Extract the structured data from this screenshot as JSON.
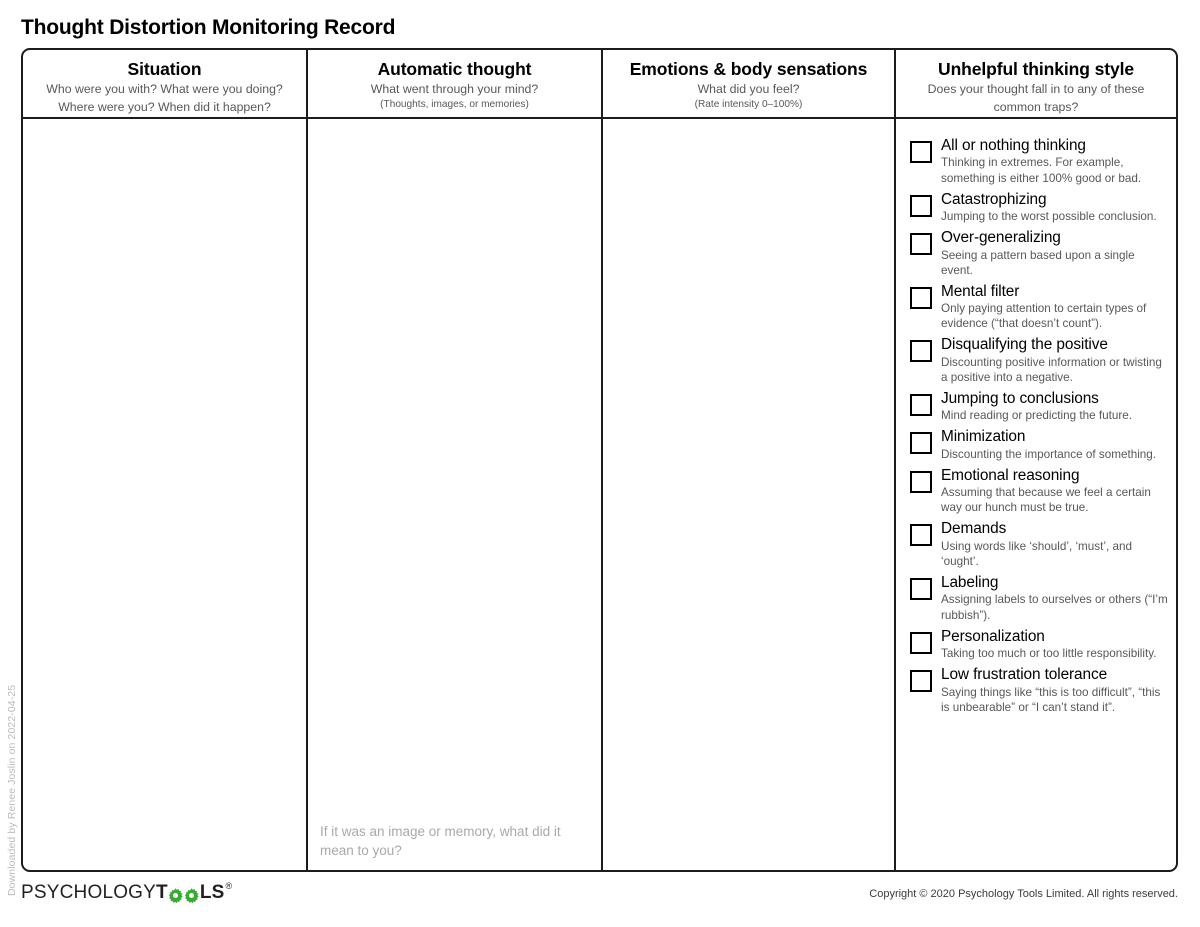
{
  "document": {
    "title": "Thought Distortion Monitoring Record",
    "download_stamp": "Downloaded by Renee Joslin on 2022-04-25"
  },
  "table": {
    "columns": [
      {
        "id": "situation",
        "title": "Situation",
        "subtitle_line1": "Who were you with? What were you doing?",
        "subtitle_line2": "Where were you?  When did it happen?"
      },
      {
        "id": "automatic-thought",
        "title": "Automatic thought",
        "subtitle_line1": "What went through your mind?",
        "subtitle_small": "(Thoughts, images, or memories)",
        "body_hint": "If it was an image or memory, what did it mean to you?"
      },
      {
        "id": "emotions",
        "title": "Emotions & body sensations",
        "subtitle_line1": "What did you feel?",
        "subtitle_small": "(Rate intensity 0–100%)"
      },
      {
        "id": "unhelpful-thinking-style",
        "title": "Unhelpful thinking style",
        "subtitle_line1": "Does your thought fall in to any of these",
        "subtitle_line2": "common traps?"
      }
    ]
  },
  "distortions": [
    {
      "label": "All or nothing thinking",
      "description": "Thinking in extremes. For example, something is either 100% good or bad.",
      "checked": false
    },
    {
      "label": "Catastrophizing",
      "description": "Jumping to the worst possible conclusion.",
      "checked": false
    },
    {
      "label": "Over-generalizing",
      "description": "Seeing a pattern based upon a single event.",
      "checked": false
    },
    {
      "label": "Mental filter",
      "description": "Only paying attention to certain types of evidence (“that doesn’t count”).",
      "checked": false
    },
    {
      "label": "Disqualifying the positive",
      "description": "Discounting positive information or twisting a positive into a negative.",
      "checked": false
    },
    {
      "label": "Jumping to conclusions",
      "description": "Mind reading or predicting the future.",
      "checked": false
    },
    {
      "label": "Minimization",
      "description": "Discounting the importance of something.",
      "checked": false
    },
    {
      "label": "Emotional reasoning",
      "description": "Assuming that because we feel a certain way our hunch must be true.",
      "checked": false
    },
    {
      "label": "Demands",
      "description": "Using words like ‘should’, ‘must’, and ‘ought’.",
      "checked": false
    },
    {
      "label": "Labeling",
      "description": "Assigning labels to ourselves or others (“I’m rubbish”).",
      "checked": false
    },
    {
      "label": "Personalization",
      "description": "Taking too much or too little responsibility.",
      "checked": false
    },
    {
      "label": "Low frustration tolerance",
      "description": "Saying things like “this is too difficult”, “this is unbearable” or “I can’t stand it”.",
      "checked": false
    }
  ],
  "footer": {
    "brand_part1": "PSYCHOLOGY",
    "brand_part2": "T",
    "brand_part3": "LS",
    "brand_registered": "®",
    "copyright": "Copyright © 2020 Psychology Tools Limited. All rights reserved."
  },
  "colors": {
    "ink": "#1c1c1c",
    "muted_text": "#58585a",
    "hint_text": "#a7a9ac",
    "watermark": "#b9bcc0",
    "brand_green": "#3aaa35"
  }
}
